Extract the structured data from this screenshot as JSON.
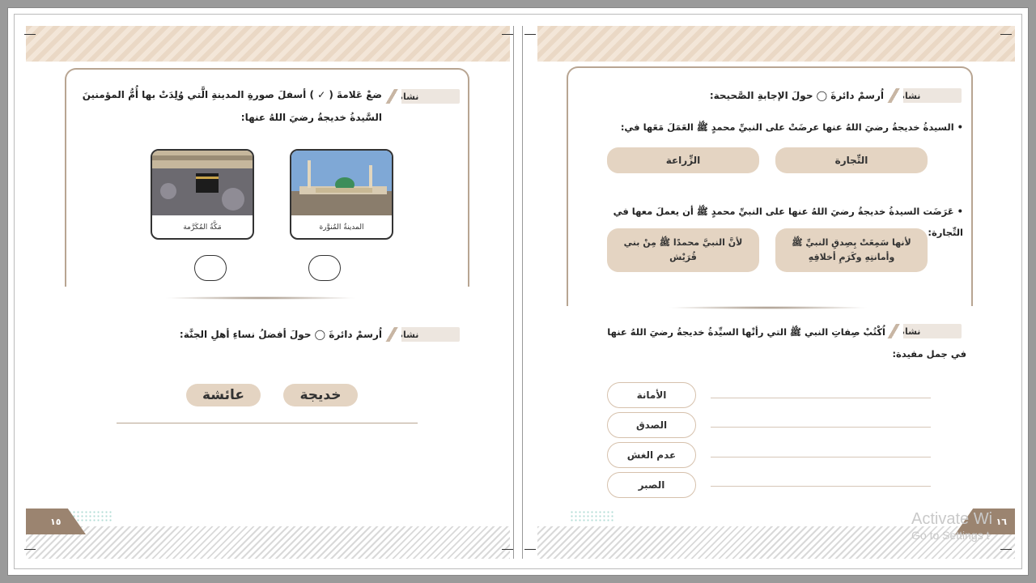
{
  "left_page": {
    "activity3": {
      "badge": "نشاط ٣",
      "instruction_line1": "ضعْ عَلامةَ ( ✓ ) أسفلَ صورةِ المدينةِ الَّتي وُلِدَتْ بها أُمُّ المؤمنينَ",
      "instruction_line2": "السَّيدةُ خديجةُ رضيَ اللهُ عنها:",
      "image_right_caption": "المدينةُ المُنوَّرة",
      "image_left_caption": "مَكَّةُ المُكَرَّمة"
    },
    "activity4": {
      "badge": "نشاط ٤",
      "instruction": "اُرسمْ دائرةَ ◯ حولَ أفضلُ نساءِ أهلِ الجنَّة:",
      "option_right": "خديجة",
      "option_left": "عائشة"
    },
    "page_number": "١٥"
  },
  "right_page": {
    "activity5": {
      "badge": "نشاط ٥",
      "instruction": "اُرسمْ دائرةَ ◯ حولَ الإجابةِ الصَّحيحة:",
      "q1": "• السيدةُ خديجةُ رضيَ اللهُ عنها عرضَتْ على النبيِّ محمدٍ ﷺ العَمَلَ مَعَها في:",
      "q1_option_right": "التِّجارة",
      "q1_option_left": "الزِّراعة",
      "q2": "• عَرَضَت السيدةُ خديجةُ رضيَ اللهُ عنها على النبيِّ محمدٍ ﷺ أن يعملَ معها في التِّجارة:",
      "q2_option_right": "لأنها سَمِعَتْ بِصِدقِ النبيِّ ﷺ وأمانتِهِ وكَرَمِ أخلاقِهِ",
      "q2_option_left": "لأنَّ النبيَّ محمدًا ﷺ مِنْ بني قُرَيْش"
    },
    "activity6": {
      "badge": "نشاط ٦",
      "instruction_line1": "اُكْتُبْ صِفاتِ النبي ﷺ التي رأتْها السيِّدةُ خديجةُ رضيَ اللهُ عنها",
      "instruction_line2": "في جمل مفيدة:",
      "words": [
        "الأمانة",
        "الصدق",
        "عدم الغش",
        "الصبر"
      ]
    },
    "page_number": "١٦"
  },
  "watermark": {
    "line1": "Activate Wi",
    "line2": "Go to Settings t"
  },
  "colors": {
    "accent": "#9b8470",
    "pill": "#e4d4c2",
    "band": "#ead8c5"
  }
}
